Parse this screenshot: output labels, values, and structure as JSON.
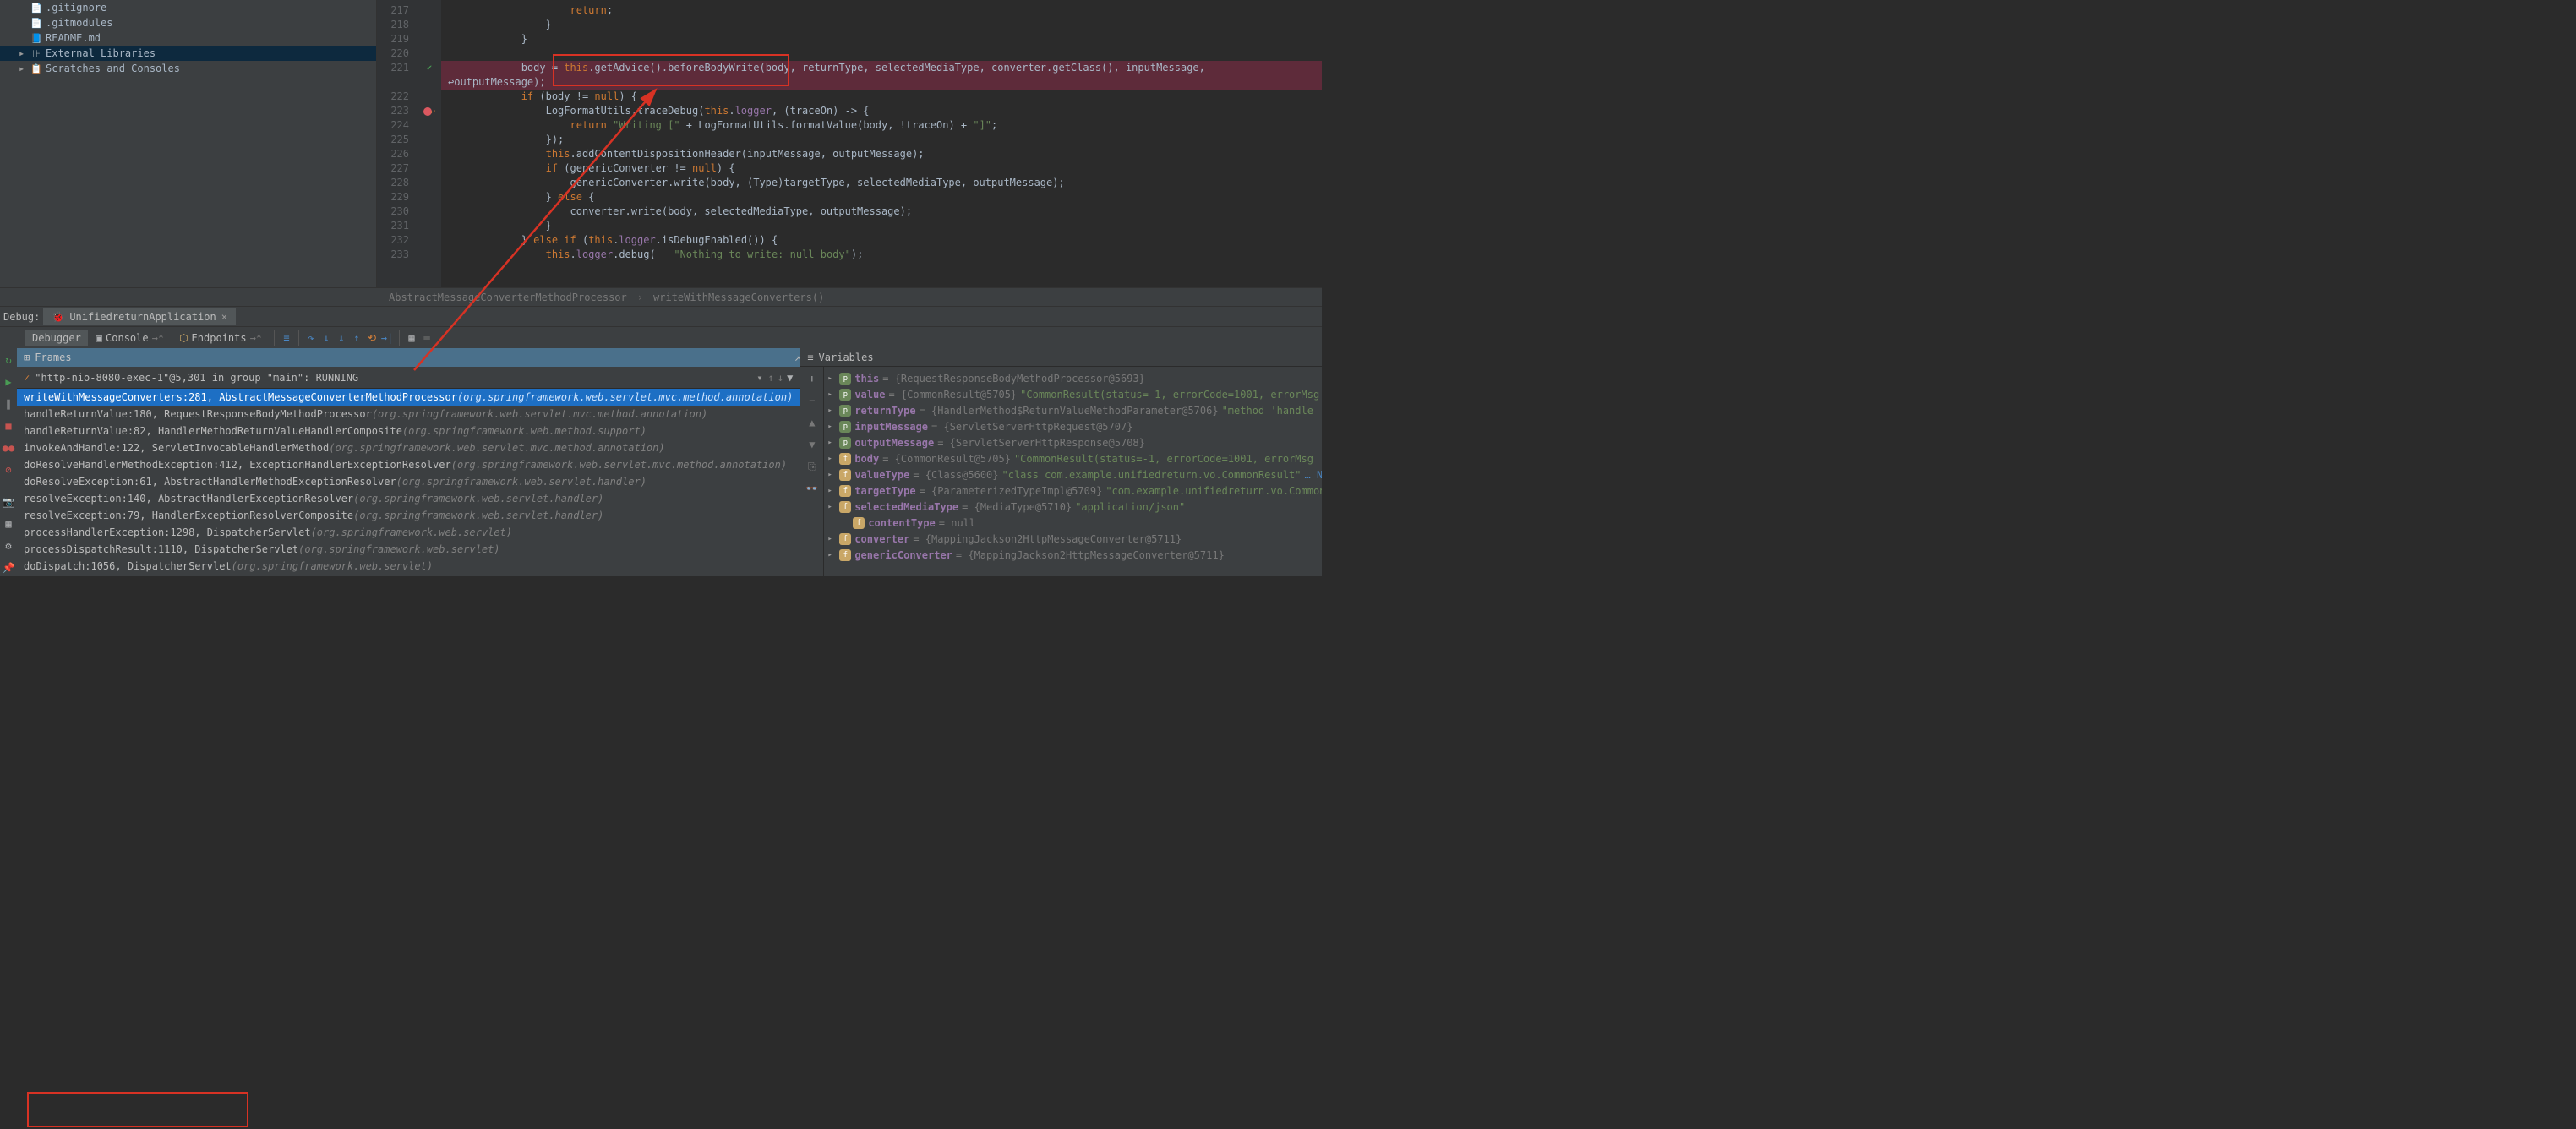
{
  "tree": {
    "items": [
      {
        "icon": "file",
        "label": ".gitignore"
      },
      {
        "icon": "file",
        "label": ".gitmodules"
      },
      {
        "icon": "md",
        "label": "README.md"
      },
      {
        "icon": "lib",
        "label": "External Libraries",
        "selected": true,
        "expandable": true
      },
      {
        "icon": "scratch",
        "label": "Scratches and Consoles",
        "expandable": true
      }
    ]
  },
  "editor": {
    "lines": [
      {
        "n": 217,
        "html": "                    <span class='kw'>return</span>;"
      },
      {
        "n": 218,
        "html": "                }"
      },
      {
        "n": 219,
        "html": "            }"
      },
      {
        "n": 220,
        "html": ""
      },
      {
        "n": 221,
        "highlight": true,
        "gutter": "check",
        "html": "            body = <span class='kw'>this</span>.getAdvice().beforeBodyWrite(body, returnType, selectedMediaType, converter.getClass(), inputMessage, ",
        "wrap": "↩outputMessage);"
      },
      {
        "n": 222,
        "html": "            <span class='kw'>if</span> (body != <span class='kw'>null</span>) {"
      },
      {
        "n": 223,
        "gutter": "bp",
        "html": "                LogFormatUtils.traceDebug(<span class='kw'>this</span>.<span class='field'>logger</span>, (traceOn) -> {"
      },
      {
        "n": 224,
        "html": "                    <span class='kw'>return</span> <span class='str'>\"Writing [\"</span> + LogFormatUtils.formatValue(body, !traceOn) + <span class='str'>\"]\"</span>;"
      },
      {
        "n": 225,
        "html": "                });"
      },
      {
        "n": 226,
        "html": "                <span class='kw'>this</span>.addContentDispositionHeader(inputMessage, outputMessage);"
      },
      {
        "n": 227,
        "html": "                <span class='kw'>if</span> (genericConverter != <span class='kw'>null</span>) {"
      },
      {
        "n": 228,
        "html": "                    genericConverter.write(body, (Type)targetType, selectedMediaType, outputMessage);"
      },
      {
        "n": 229,
        "html": "                } <span class='kw'>else</span> {"
      },
      {
        "n": 230,
        "html": "                    converter.write(body, selectedMediaType, outputMessage);"
      },
      {
        "n": 231,
        "html": "                }"
      },
      {
        "n": 232,
        "html": "            } <span class='kw'>else if</span> (<span class='kw'>this</span>.<span class='field'>logger</span>.isDebugEnabled()) {"
      },
      {
        "n": 233,
        "html": "                <span class='kw'>this</span>.<span class='field'>logger</span>.debug(   <span class='str'>\"Nothing to write: null body\"</span>);"
      }
    ]
  },
  "breadcrumb": {
    "class": "AbstractMessageConverterMethodProcessor",
    "method": "writeWithMessageConverters()"
  },
  "debug": {
    "label": "Debug:",
    "app": "UnifiedreturnApplication"
  },
  "toolbar": {
    "tabs": [
      "Debugger",
      "Console",
      "Endpoints"
    ]
  },
  "frames": {
    "title": "Frames",
    "thread": "\"http-nio-8080-exec-1\"@5,301 in group \"main\": RUNNING",
    "items": [
      {
        "sel": true,
        "m": "writeWithMessageConverters:281, AbstractMessageConverterMethodProcessor ",
        "pkg": "(org.springframework.web.servlet.mvc.method.annotation)"
      },
      {
        "m": "handleReturnValue:180, RequestResponseBodyMethodProcessor ",
        "pkg": "(org.springframework.web.servlet.mvc.method.annotation)"
      },
      {
        "m": "handleReturnValue:82, HandlerMethodReturnValueHandlerComposite ",
        "pkg": "(org.springframework.web.method.support)"
      },
      {
        "m": "invokeAndHandle:122, ServletInvocableHandlerMethod ",
        "pkg": "(org.springframework.web.servlet.mvc.method.annotation)"
      },
      {
        "m": "doResolveHandlerMethodException:412, ExceptionHandlerExceptionResolver ",
        "pkg": "(org.springframework.web.servlet.mvc.method.annotation)"
      },
      {
        "m": "doResolveException:61, AbstractHandlerMethodExceptionResolver ",
        "pkg": "(org.springframework.web.servlet.handler)"
      },
      {
        "m": "resolveException:140, AbstractHandlerExceptionResolver ",
        "pkg": "(org.springframework.web.servlet.handler)"
      },
      {
        "m": "resolveException:79, HandlerExceptionResolverComposite ",
        "pkg": "(org.springframework.web.servlet.handler)"
      },
      {
        "m": "processHandlerException:1298, DispatcherServlet ",
        "pkg": "(org.springframework.web.servlet)"
      },
      {
        "m": "processDispatchResult:1110, DispatcherServlet ",
        "pkg": "(org.springframework.web.servlet)"
      },
      {
        "m": "doDispatch:1056, DispatcherServlet ",
        "pkg": "(org.springframework.web.servlet)"
      }
    ]
  },
  "vars": {
    "title": "Variables",
    "items": [
      {
        "icon": "p",
        "name": "this",
        "val": " = {RequestResponseBodyMethodProcessor@5693}"
      },
      {
        "icon": "p",
        "name": "value",
        "val": " = {CommonResult@5705} ",
        "str": "\"CommonResult(status=-1, errorCode=1001, errorMsg"
      },
      {
        "icon": "p",
        "name": "returnType",
        "val": " = {HandlerMethod$ReturnValueMethodParameter@5706} ",
        "str": "\"method 'handle"
      },
      {
        "icon": "p",
        "name": "inputMessage",
        "val": " = {ServletServerHttpRequest@5707}"
      },
      {
        "icon": "p",
        "name": "outputMessage",
        "val": " = {ServletServerHttpResponse@5708}"
      },
      {
        "icon": "f",
        "name": "body",
        "val": " = {CommonResult@5705} ",
        "str": "\"CommonResult(status=-1, errorCode=1001, errorMsg"
      },
      {
        "icon": "f",
        "name": "valueType",
        "val": " = {Class@5600} ",
        "str": "\"class com.example.unifiedreturn.vo.CommonResult\"",
        "tail": " … Na"
      },
      {
        "icon": "f",
        "name": "targetType",
        "val": " = {ParameterizedTypeImpl@5709} ",
        "str": "\"com.example.unifiedreturn.vo.Common"
      },
      {
        "icon": "f",
        "name": "selectedMediaType",
        "val": " = {MediaType@5710} ",
        "str": "\"application/json\""
      },
      {
        "icon": "f",
        "indent": true,
        "noarrow": true,
        "name": "contentType",
        "val": " = null"
      },
      {
        "icon": "f",
        "name": "converter",
        "val": " = {MappingJackson2HttpMessageConverter@5711}"
      },
      {
        "icon": "f",
        "name": "genericConverter",
        "val": " = {MappingJackson2HttpMessageConverter@5711}"
      }
    ]
  }
}
